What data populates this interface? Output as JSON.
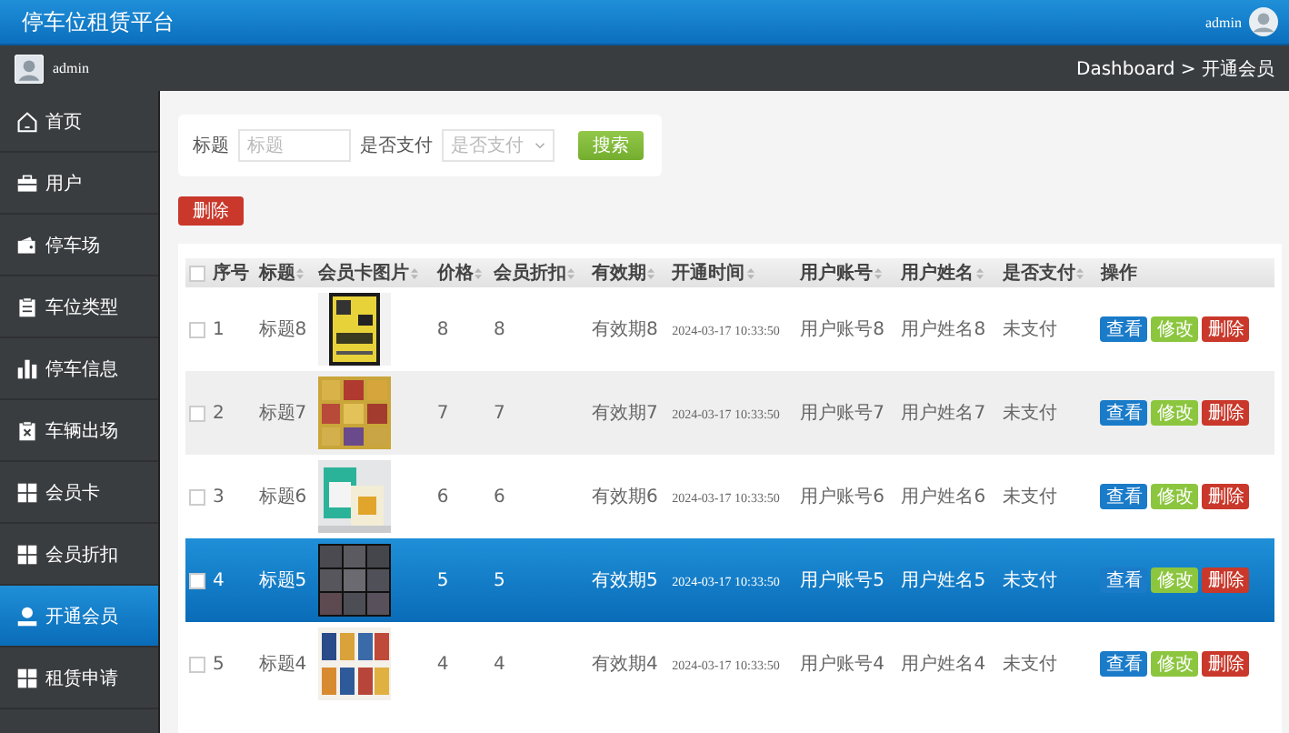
{
  "header": {
    "title": "停车位租赁平台",
    "user": "admin"
  },
  "subheader": {
    "user": "admin",
    "breadcrumb": "Dashboard > 开通会员"
  },
  "sidebar": {
    "items": [
      {
        "label": "首页",
        "selected": false
      },
      {
        "label": "用户",
        "selected": false
      },
      {
        "label": "停车场",
        "selected": false
      },
      {
        "label": "车位类型",
        "selected": false
      },
      {
        "label": "停车信息",
        "selected": false
      },
      {
        "label": "车辆出场",
        "selected": false
      },
      {
        "label": "会员卡",
        "selected": false
      },
      {
        "label": "会员折扣",
        "selected": false
      },
      {
        "label": "开通会员",
        "selected": true
      },
      {
        "label": "租赁申请",
        "selected": false
      }
    ]
  },
  "search": {
    "title_label": "标题",
    "title_placeholder": "标题",
    "pay_label": "是否支付",
    "pay_placeholder": "是否支付",
    "button": "搜索"
  },
  "delete_button": "删除",
  "table": {
    "select_all": {
      "checked": false
    },
    "columns": [
      {
        "label": "序号",
        "sortable": false
      },
      {
        "label": "标题",
        "sortable": true
      },
      {
        "label": "会员卡图片",
        "sortable": true
      },
      {
        "label": "价格",
        "sortable": true
      },
      {
        "label": "会员折扣",
        "sortable": true
      },
      {
        "label": "有效期",
        "sortable": true
      },
      {
        "label": "开通时间",
        "sortable": true
      },
      {
        "label": "用户账号",
        "sortable": true
      },
      {
        "label": "用户姓名",
        "sortable": true
      },
      {
        "label": "是否支付",
        "sortable": true
      },
      {
        "label": "操作",
        "sortable": false
      }
    ],
    "rows": [
      {
        "checked": false,
        "selected": false,
        "cells": [
          {
            "kind": "text",
            "text": "1"
          },
          {
            "kind": "text",
            "text": "标题8"
          },
          {
            "kind": "picture"
          },
          {
            "kind": "text",
            "text": "8"
          },
          {
            "kind": "text",
            "text": "8"
          },
          {
            "kind": "text",
            "text": "有效期8"
          },
          {
            "kind": "time",
            "text": "2024-03-17 10:33:50"
          },
          {
            "kind": "text",
            "text": "用户账号8"
          },
          {
            "kind": "text",
            "text": "用户姓名8"
          },
          {
            "kind": "text",
            "text": "未支付"
          },
          {
            "kind": "actions",
            "buttons": [
              "查看",
              "修改",
              "删除"
            ]
          }
        ]
      },
      {
        "checked": false,
        "selected": false,
        "cells": [
          {
            "kind": "text",
            "text": "2"
          },
          {
            "kind": "text",
            "text": "标题7"
          },
          {
            "kind": "picture"
          },
          {
            "kind": "text",
            "text": "7"
          },
          {
            "kind": "text",
            "text": "7"
          },
          {
            "kind": "text",
            "text": "有效期7"
          },
          {
            "kind": "time",
            "text": "2024-03-17 10:33:50"
          },
          {
            "kind": "text",
            "text": "用户账号7"
          },
          {
            "kind": "text",
            "text": "用户姓名7"
          },
          {
            "kind": "text",
            "text": "未支付"
          },
          {
            "kind": "actions",
            "buttons": [
              "查看",
              "修改",
              "删除"
            ]
          }
        ]
      },
      {
        "checked": false,
        "selected": false,
        "cells": [
          {
            "kind": "text",
            "text": "3"
          },
          {
            "kind": "text",
            "text": "标题6"
          },
          {
            "kind": "picture"
          },
          {
            "kind": "text",
            "text": "6"
          },
          {
            "kind": "text",
            "text": "6"
          },
          {
            "kind": "text",
            "text": "有效期6"
          },
          {
            "kind": "time",
            "text": "2024-03-17 10:33:50"
          },
          {
            "kind": "text",
            "text": "用户账号6"
          },
          {
            "kind": "text",
            "text": "用户姓名6"
          },
          {
            "kind": "text",
            "text": "未支付"
          },
          {
            "kind": "actions",
            "buttons": [
              "查看",
              "修改",
              "删除"
            ]
          }
        ]
      },
      {
        "checked": false,
        "selected": true,
        "cells": [
          {
            "kind": "text",
            "text": "4"
          },
          {
            "kind": "text",
            "text": "标题5"
          },
          {
            "kind": "picture"
          },
          {
            "kind": "text",
            "text": "5"
          },
          {
            "kind": "text",
            "text": "5"
          },
          {
            "kind": "text",
            "text": "有效期5"
          },
          {
            "kind": "time",
            "text": "2024-03-17 10:33:50"
          },
          {
            "kind": "text",
            "text": "用户账号5"
          },
          {
            "kind": "text",
            "text": "用户姓名5"
          },
          {
            "kind": "text",
            "text": "未支付"
          },
          {
            "kind": "actions",
            "buttons": [
              "查看",
              "修改",
              "删除"
            ]
          }
        ]
      },
      {
        "checked": false,
        "selected": false,
        "cells": [
          {
            "kind": "text",
            "text": "5"
          },
          {
            "kind": "text",
            "text": "标题4"
          },
          {
            "kind": "picture"
          },
          {
            "kind": "text",
            "text": "4"
          },
          {
            "kind": "text",
            "text": "4"
          },
          {
            "kind": "text",
            "text": "有效期4"
          },
          {
            "kind": "time",
            "text": "2024-03-17 10:33:50"
          },
          {
            "kind": "text",
            "text": "用户账号4"
          },
          {
            "kind": "text",
            "text": "用户姓名4"
          },
          {
            "kind": "text",
            "text": "未支付"
          },
          {
            "kind": "actions",
            "buttons": [
              "查看",
              "修改",
              "删除"
            ]
          }
        ]
      }
    ]
  }
}
